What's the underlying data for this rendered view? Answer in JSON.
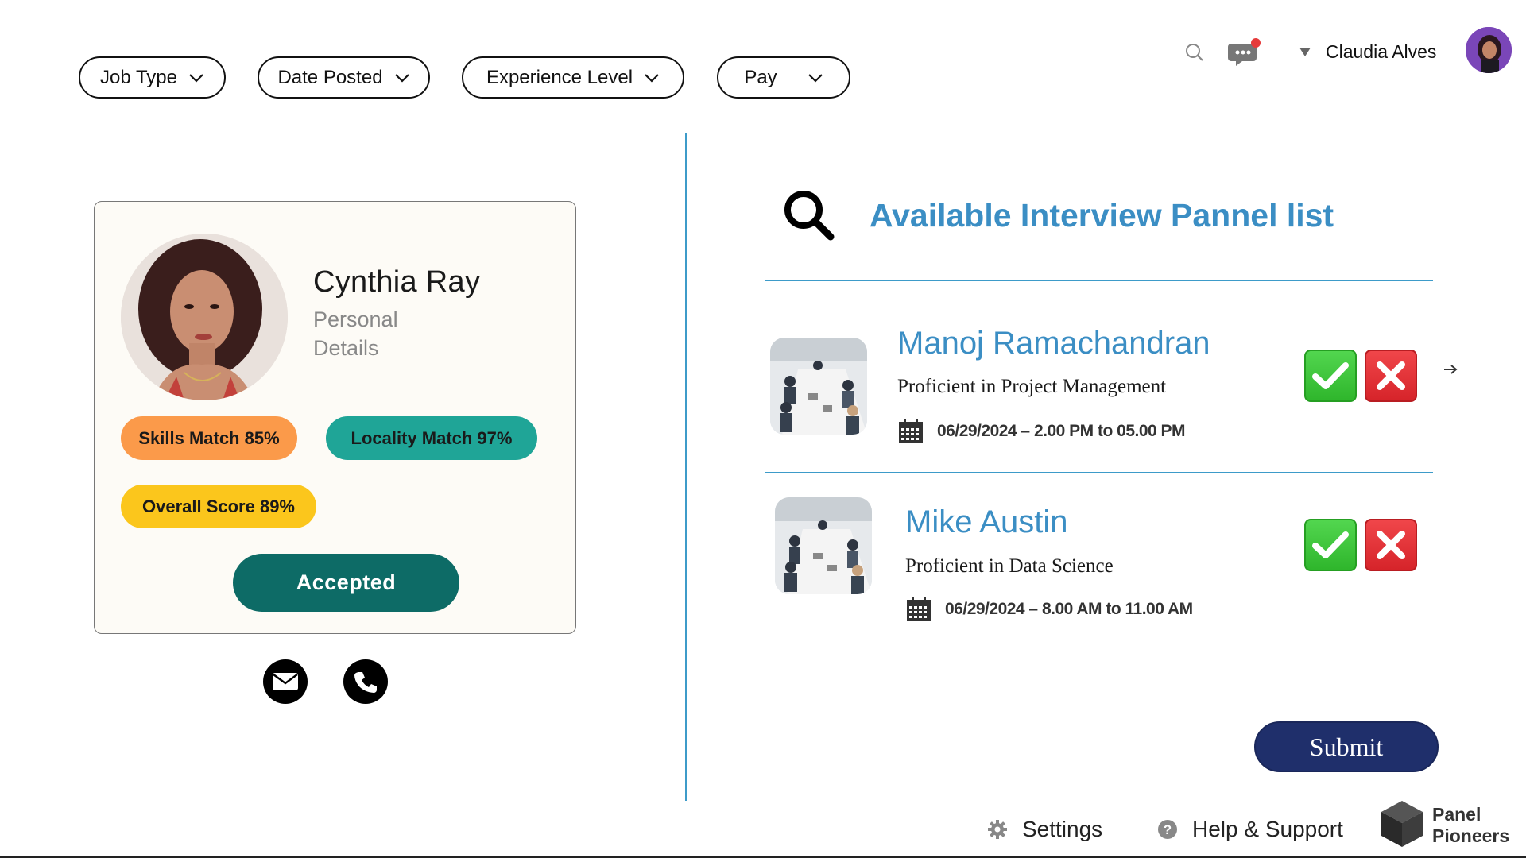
{
  "filters": [
    {
      "label": "Job Type"
    },
    {
      "label": "Date Posted"
    },
    {
      "label": "Experience Level"
    },
    {
      "label": "Pay"
    }
  ],
  "header": {
    "user_name": "Claudia Alves",
    "icons": [
      "search-icon",
      "chat-notification-icon",
      "dropdown-caret-icon"
    ],
    "notification_color": "#e63b3b"
  },
  "candidate": {
    "name": "Cynthia Ray",
    "subtitle": "Personal Details",
    "badges": {
      "skills": "Skills Match 85%",
      "locality": "Locality Match 97%",
      "overall": "Overall Score 89%"
    },
    "status": "Accepted",
    "badge_colors": {
      "skills": "#fb9a4a",
      "locality": "#1fa597",
      "overall": "#fbc61c"
    },
    "contact_icons": [
      "mail-icon",
      "phone-icon"
    ]
  },
  "panel": {
    "title": "Available Interview Pannel list",
    "members": [
      {
        "name": "Manoj Ramachandran",
        "skill": "Proficient in Project Management",
        "schedule": "06/29/2024 – 2.00 PM to 05.00 PM"
      },
      {
        "name": "Mike Austin",
        "skill": "Proficient in Data Science",
        "schedule": "06/29/2024 – 8.00 AM to 11.00 AM"
      }
    ],
    "accent": "#3b8ec4"
  },
  "submit_label": "Submit",
  "footer": {
    "settings": "Settings",
    "help": "Help & Support",
    "brand_line1": "Panel",
    "brand_line2": "Pioneers"
  }
}
